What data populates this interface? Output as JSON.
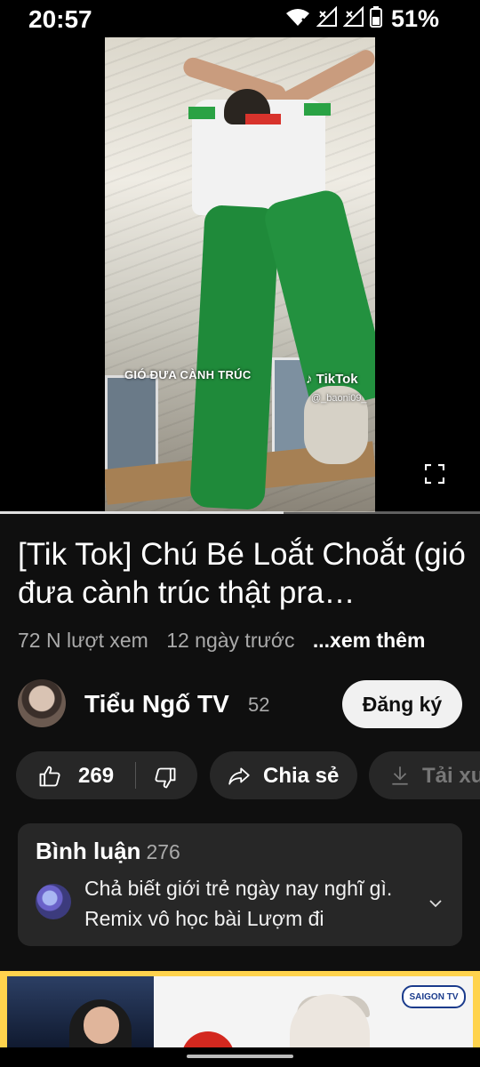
{
  "status_bar": {
    "time": "20:57",
    "battery_percent": "51%",
    "icons": [
      "wifi-x-icon",
      "signal-x-icon",
      "signal-x-icon",
      "battery-icon"
    ]
  },
  "video": {
    "caption_overlay": "GIÓ ĐƯA CÀNH TRÚC",
    "watermark": "TikTok",
    "watermark_user": "@_baoni09_",
    "progress": 0.59
  },
  "title": "[Tik Tok] Chú Bé Loắt Choắt (gió đưa cành trúc thật pra…",
  "meta": {
    "views": "72 N lượt xem",
    "age": "12 ngày trước",
    "more": "...xem thêm"
  },
  "channel": {
    "name": "Tiểu Ngố TV",
    "subscribers": "52",
    "subscribe_label": "Đăng ký"
  },
  "actions": {
    "likes": "269",
    "share_label": "Chia sẻ",
    "download_label": "Tải xuống"
  },
  "comments": {
    "title": "Bình luận",
    "count": "276",
    "top_comment": "Chả biết giới trẻ ngày nay nghĩ gì. Remix vô học bài Lượm đi"
  },
  "ad": {
    "logo_text": "SAIGON TV"
  },
  "colors": {
    "background": "#0f0f0f",
    "pill": "#272727",
    "subscribe_bg": "#f1f1f1",
    "ad_border": "#ffd34d"
  }
}
